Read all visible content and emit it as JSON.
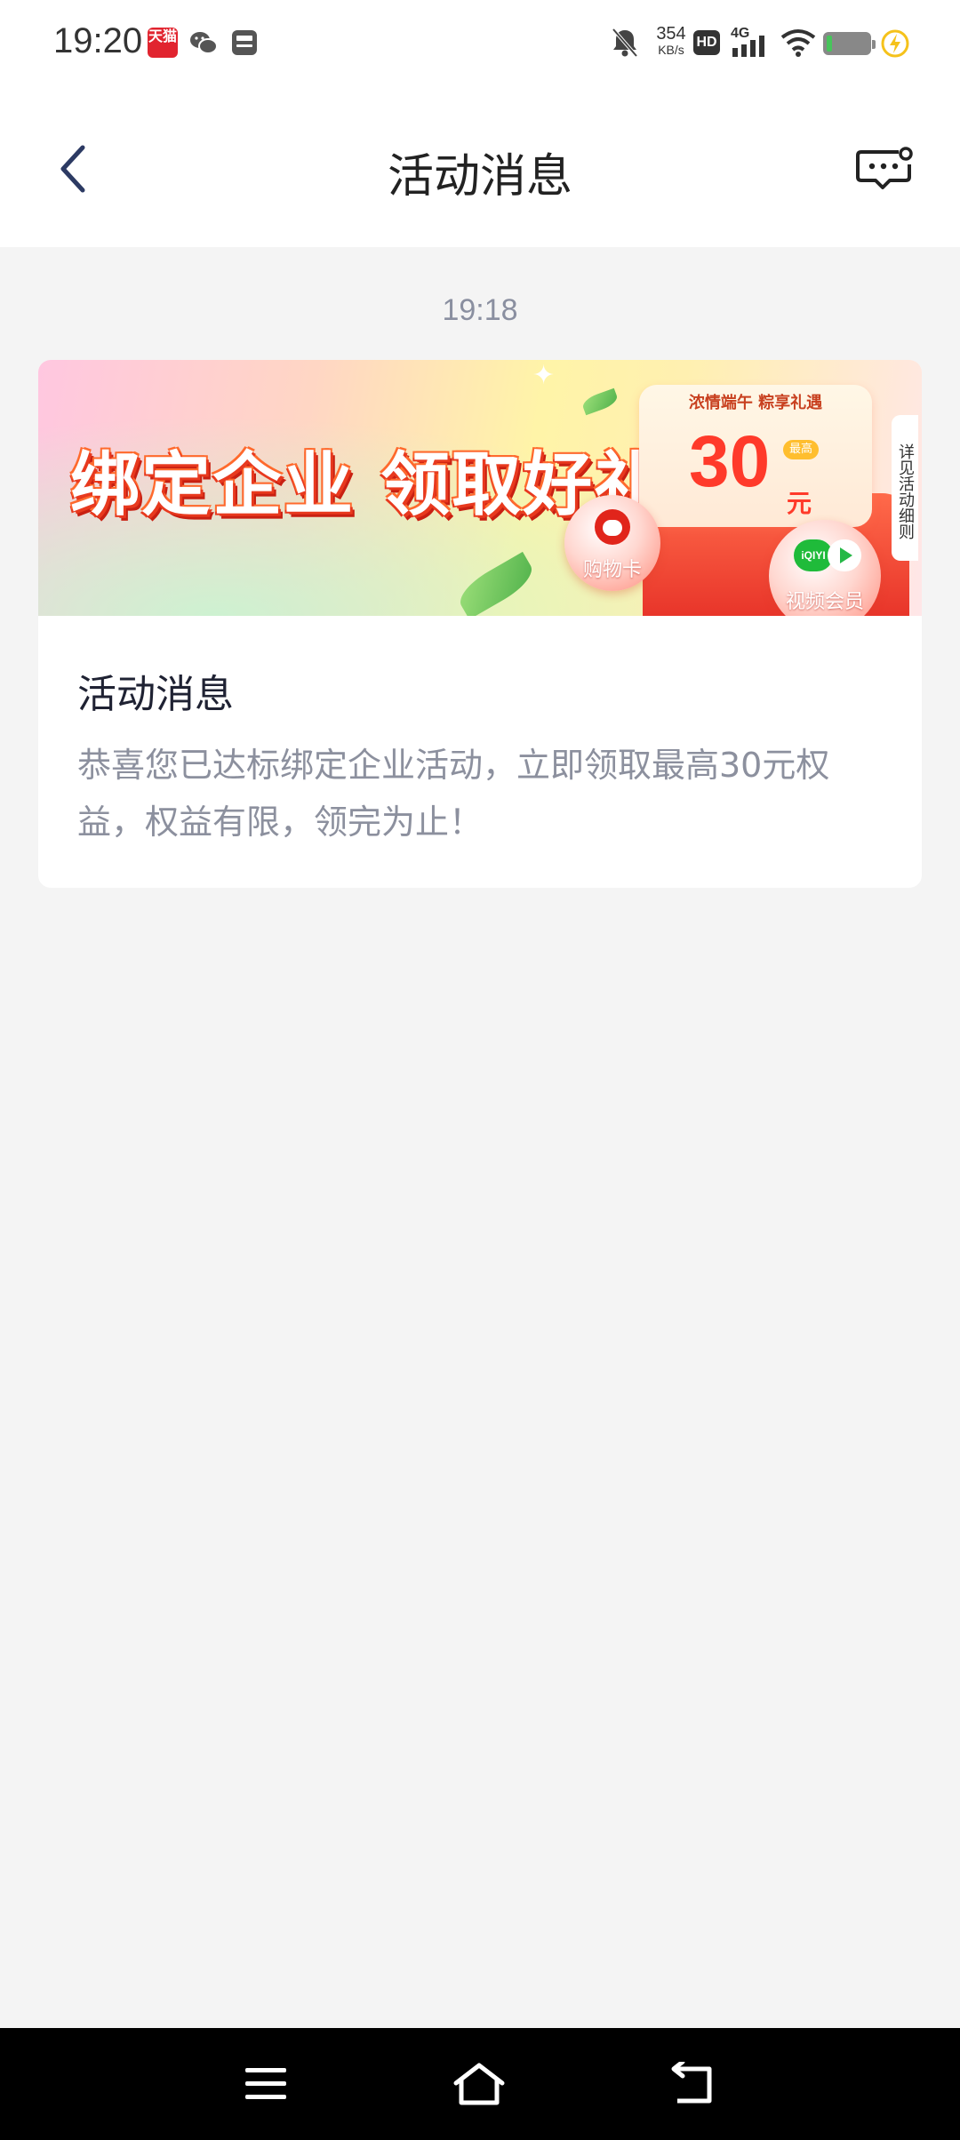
{
  "status_bar": {
    "time": "19:20",
    "net_speed_value": "354",
    "net_speed_unit": "KB/s",
    "hd_label": "HD",
    "network_type": "4G",
    "tmall_label": "天猫",
    "icons": [
      "tmall-icon",
      "wechat-icon",
      "bus-icon",
      "mute-bell-icon",
      "signal-icon",
      "wifi-icon",
      "battery-icon",
      "charging-icon"
    ]
  },
  "header": {
    "title": "活动消息",
    "back_icon": "chevron-left-icon",
    "service_icon": "message-settings-icon"
  },
  "message": {
    "timestamp": "19:18",
    "banner": {
      "headline": "绑定企业 领取好礼",
      "gift_tag": "浓情端午 粽享礼遇",
      "gift_amount": "30",
      "gift_unit": "元",
      "gift_badge": "最高",
      "side_tab": "详见活动细则",
      "jd_label": "购物卡",
      "iqiyi_logo": "iQIYI",
      "iqiyi_label": "视频会员"
    },
    "title": "活动消息",
    "body": "恭喜您已达标绑定企业活动，立即领取最高30元权益，权益有限，领完为止！"
  },
  "system_nav": {
    "icons": [
      "menu-icon",
      "home-icon",
      "back-icon"
    ]
  },
  "colors": {
    "page_bg": "#f4f4f4",
    "card_bg": "#ffffff",
    "title_text": "#1f2233",
    "body_text": "#8c909e",
    "accent_red": "#ff3a2a"
  }
}
